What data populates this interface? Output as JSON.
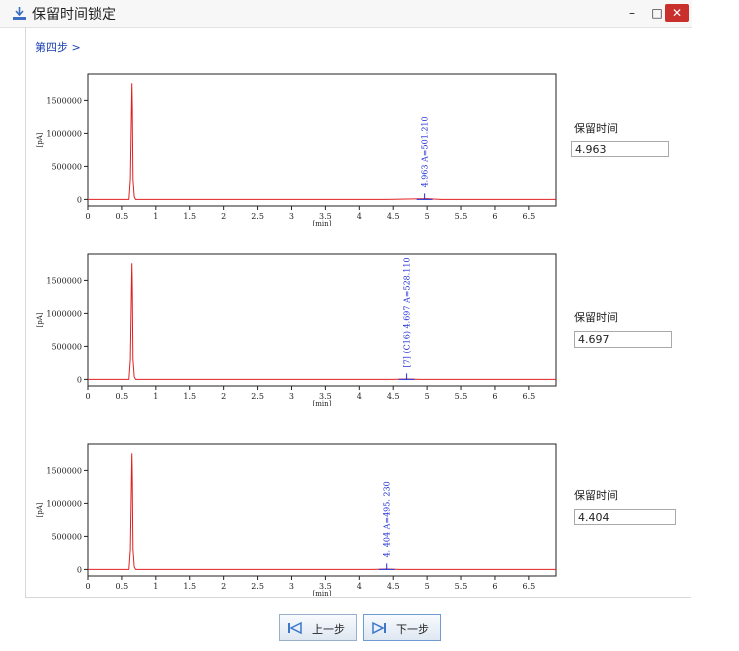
{
  "window": {
    "title": "保留时间锁定",
    "minimize_glyph": "–",
    "maximize_glyph": "□",
    "close_glyph": "✕"
  },
  "breadcrumb": "第四步 >",
  "panels": [
    {
      "label": "保留时间",
      "value": "4.963",
      "annotation": "4.963 A=501.210"
    },
    {
      "label": "保留时间",
      "value": "4.697",
      "annotation": "[7] (C16) 4.697 A=528.110"
    },
    {
      "label": "保留时间",
      "value": "4.404",
      "annotation": "4. 404 A=495. 230"
    }
  ],
  "buttons": {
    "prev": "上一步",
    "next": "下一步"
  },
  "icons": {
    "title": "window-app-icon",
    "prev": "skip-back-icon",
    "next": "skip-forward-icon"
  },
  "colors": {
    "trace": "#e02020",
    "annotation": "#1f2fd6",
    "accent": "#1a3fb0"
  },
  "chart_data": [
    {
      "type": "line",
      "xlabel": "[min]",
      "ylabel": "[pA]",
      "xlim": [
        0,
        6.9
      ],
      "ylim": [
        -100000,
        1900000
      ],
      "xticks": [
        0,
        0.5,
        1,
        1.5,
        2,
        2.5,
        3,
        3.5,
        4,
        4.5,
        5,
        5.5,
        6,
        6.5
      ],
      "yticks": [
        0,
        500000,
        1000000,
        1500000
      ],
      "x": [
        0,
        0.6,
        0.62,
        0.64,
        0.645,
        0.65,
        0.66,
        0.68,
        0.7,
        4.4,
        4.8,
        5.0,
        5.2,
        6.9
      ],
      "y": [
        0,
        0,
        300000,
        1500000,
        1760000,
        1400000,
        300000,
        40000,
        0,
        0,
        8000,
        12000,
        0,
        0
      ],
      "peak": {
        "x": 4.963,
        "label": "4.963 A=501.210"
      }
    },
    {
      "type": "line",
      "xlabel": "[min]",
      "ylabel": "[pA]",
      "xlim": [
        0,
        6.9
      ],
      "ylim": [
        -100000,
        1900000
      ],
      "xticks": [
        0,
        0.5,
        1,
        1.5,
        2,
        2.5,
        3,
        3.5,
        4,
        4.5,
        5,
        5.5,
        6,
        6.5
      ],
      "yticks": [
        0,
        500000,
        1000000,
        1500000
      ],
      "x": [
        0,
        0.6,
        0.62,
        0.64,
        0.645,
        0.65,
        0.66,
        0.68,
        0.7,
        4.5,
        4.7,
        4.9,
        6.9
      ],
      "y": [
        0,
        0,
        300000,
        1500000,
        1760000,
        1400000,
        300000,
        40000,
        0,
        0,
        6000,
        0,
        0
      ],
      "peak": {
        "x": 4.697,
        "label": "[7] (C16) 4.697 A=528.110"
      }
    },
    {
      "type": "line",
      "xlabel": "[min]",
      "ylabel": "[pA]",
      "xlim": [
        0,
        6.9
      ],
      "ylim": [
        -100000,
        1900000
      ],
      "xticks": [
        0,
        0.5,
        1,
        1.5,
        2,
        2.5,
        3,
        3.5,
        4,
        4.5,
        5,
        5.5,
        6,
        6.5
      ],
      "yticks": [
        0,
        500000,
        1000000,
        1500000
      ],
      "x": [
        0,
        0.6,
        0.62,
        0.64,
        0.645,
        0.65,
        0.66,
        0.68,
        0.7,
        4.2,
        4.4,
        4.6,
        6.9
      ],
      "y": [
        0,
        0,
        300000,
        1500000,
        1760000,
        1400000,
        300000,
        40000,
        0,
        0,
        6000,
        0,
        0
      ],
      "peak": {
        "x": 4.404,
        "label": "4. 404 A=495. 230"
      }
    }
  ]
}
